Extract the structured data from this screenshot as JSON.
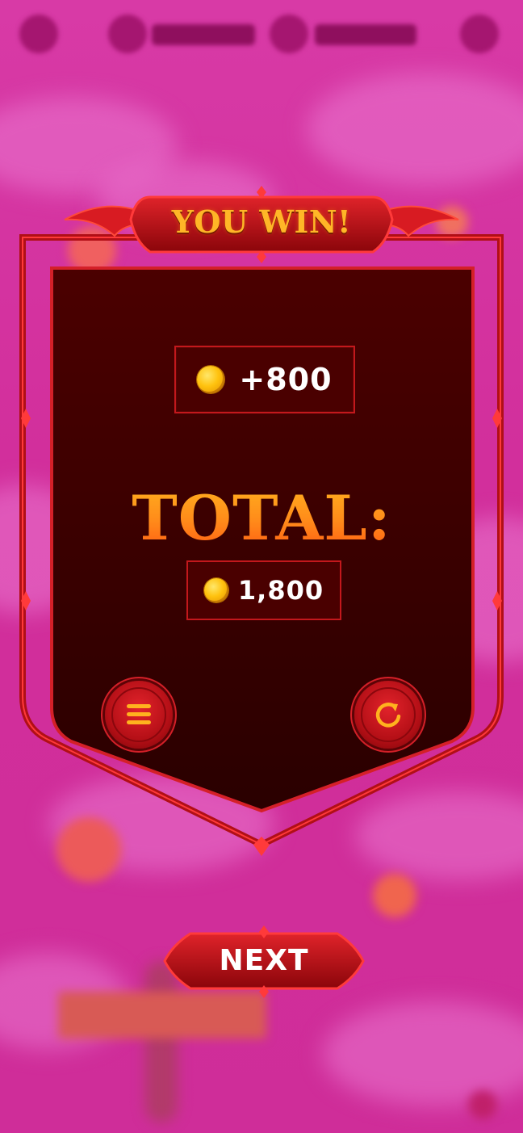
{
  "colors": {
    "background": "#d4309a",
    "panel": "#3a0000",
    "frame_red": "#d42028",
    "gold": "#ffb21e",
    "coin": "#ffc20e",
    "text_white": "#ffffff"
  },
  "modal": {
    "title": "YOU WIN!",
    "reward": {
      "icon": "coin-icon",
      "value": "+800"
    },
    "total_label": "TOTAL:",
    "total": {
      "icon": "coin-icon",
      "value": "1,800"
    },
    "buttons": {
      "menu_icon": "menu-icon",
      "restart_icon": "restart-icon"
    }
  },
  "next_button": {
    "label": "NEXT"
  }
}
